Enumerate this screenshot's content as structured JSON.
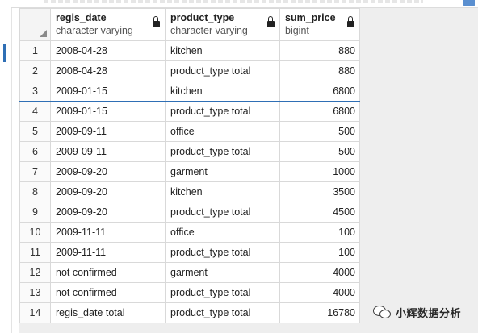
{
  "columns": [
    {
      "name": "regis_date",
      "type": "character varying"
    },
    {
      "name": "product_type",
      "type": "character varying"
    },
    {
      "name": "sum_price",
      "type": "bigint"
    }
  ],
  "rows": [
    {
      "n": "1",
      "regis_date": "2008-04-28",
      "product_type": "kitchen",
      "sum_price": "880"
    },
    {
      "n": "2",
      "regis_date": "2008-04-28",
      "product_type": "product_type total",
      "sum_price": "880"
    },
    {
      "n": "3",
      "regis_date": "2009-01-15",
      "product_type": "kitchen",
      "sum_price": "6800"
    },
    {
      "n": "4",
      "regis_date": "2009-01-15",
      "product_type": "product_type total",
      "sum_price": "6800"
    },
    {
      "n": "5",
      "regis_date": "2009-09-11",
      "product_type": "office",
      "sum_price": "500"
    },
    {
      "n": "6",
      "regis_date": "2009-09-11",
      "product_type": "product_type total",
      "sum_price": "500"
    },
    {
      "n": "7",
      "regis_date": "2009-09-20",
      "product_type": "garment",
      "sum_price": "1000"
    },
    {
      "n": "8",
      "regis_date": "2009-09-20",
      "product_type": "kitchen",
      "sum_price": "3500"
    },
    {
      "n": "9",
      "regis_date": "2009-09-20",
      "product_type": "product_type total",
      "sum_price": "4500"
    },
    {
      "n": "10",
      "regis_date": "2009-11-11",
      "product_type": "office",
      "sum_price": "100"
    },
    {
      "n": "11",
      "regis_date": "2009-11-11",
      "product_type": "product_type total",
      "sum_price": "100"
    },
    {
      "n": "12",
      "regis_date": "not confirmed",
      "product_type": "garment",
      "sum_price": "4000"
    },
    {
      "n": "13",
      "regis_date": "not confirmed",
      "product_type": "product_type total",
      "sum_price": "4000"
    },
    {
      "n": "14",
      "regis_date": "regis_date total",
      "product_type": "product_type total",
      "sum_price": "16780"
    }
  ],
  "selected_row": "3",
  "watermark": {
    "text": "小辉数据分析",
    "icon": "wechat-icon"
  },
  "colors": {
    "accent": "#2f6fb5",
    "grid_line": "#d9d9d9",
    "pane_background": "#eeeeee"
  }
}
